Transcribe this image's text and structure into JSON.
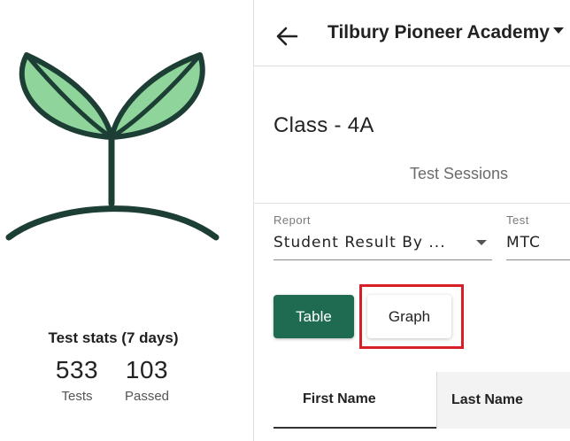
{
  "sidebar": {
    "logo_icon": "sprout-icon",
    "stats": {
      "title": "Test stats (7 days)",
      "tests_count": "533",
      "tests_label": "Tests",
      "passed_count": "103",
      "passed_label": "Passed"
    }
  },
  "header": {
    "back_icon": "arrow-left-icon",
    "school_name": "Tilbury Pioneer Academy",
    "dropdown_icon": "caret-down-icon"
  },
  "main": {
    "class_title": "Class - 4A",
    "tabs": [
      {
        "label": "Test Sessions"
      }
    ],
    "filters": {
      "report": {
        "label": "Report",
        "value": "Student Result By ..."
      },
      "test": {
        "label": "Test",
        "value": "MTC"
      }
    },
    "view_toggle": {
      "table_label": "Table",
      "graph_label": "Graph"
    },
    "table": {
      "columns": [
        "First Name",
        "Last Name"
      ]
    }
  },
  "colors": {
    "primary": "#1e6b52",
    "leaf_fill": "#8fd49a",
    "outline": "#1d3e35",
    "highlight": "#d61f26"
  }
}
